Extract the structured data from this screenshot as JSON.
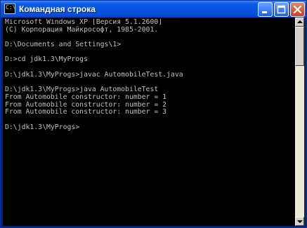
{
  "window": {
    "title": "Командная строка",
    "icon": "console-icon",
    "icon_glyph": "C:\\"
  },
  "titlebar_buttons": [
    {
      "name": "minimize-button",
      "icon": "minimize-icon"
    },
    {
      "name": "maximize-button",
      "icon": "maximize-icon"
    },
    {
      "name": "close-button",
      "icon": "close-icon"
    }
  ],
  "console": {
    "lines": [
      "Microsoft Windows XP [Версия 5.1.2600]",
      "(С) Корпорация Майкрософт, 1985-2001.",
      "",
      "D:\\Documents and Settings\\1>",
      "",
      "D:>cd jdk1.3\\MyProgs",
      "",
      "D:\\jdk1.3\\MyProgs>javac AutomobileTest.java",
      "",
      "D:\\jdk1.3\\MyProgs>java AutomobileTest",
      "From Automobile constructor: number = 1",
      "From Automobile constructor: number = 2",
      "From Automobile constructor: number = 3",
      "",
      "D:\\jdk1.3\\MyProgs>"
    ]
  },
  "scrollbar": {
    "up_icon": "arrow-up-icon",
    "down_icon": "arrow-down-icon",
    "position": 0
  },
  "colors": {
    "title_bar": "#0a5ce6",
    "console_bg": "#000000",
    "console_fg": "#c0c0c0",
    "close_button": "#c44020"
  }
}
